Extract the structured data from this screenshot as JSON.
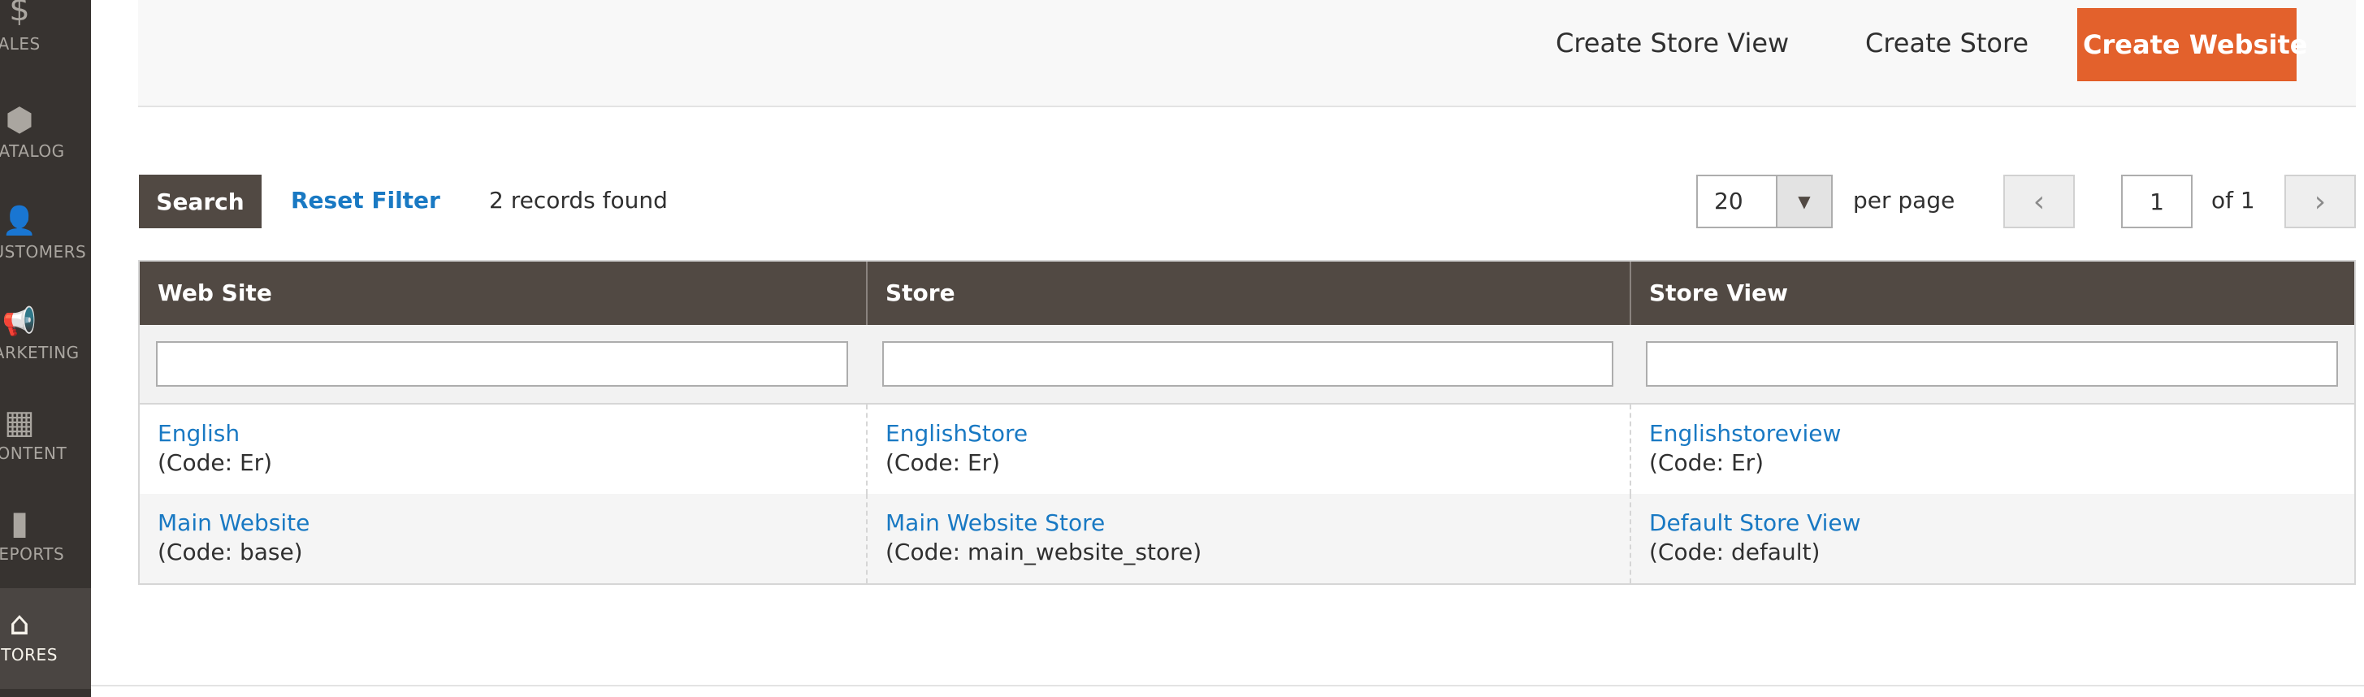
{
  "sidebar": {
    "items": [
      {
        "label": "SALES",
        "icon": "dollar-icon",
        "glyph": "$"
      },
      {
        "label": "CATALOG",
        "icon": "box-icon",
        "glyph": "⬢"
      },
      {
        "label": "CUSTOMERS",
        "icon": "person-icon",
        "glyph": "👤"
      },
      {
        "label": "MARKETING",
        "icon": "megaphone-icon",
        "glyph": "📢"
      },
      {
        "label": "CONTENT",
        "icon": "layout-icon",
        "glyph": "▦"
      },
      {
        "label": "REPORTS",
        "icon": "bar-chart-icon",
        "glyph": "▮"
      },
      {
        "label": "STORES",
        "icon": "store-icon",
        "glyph": "⌂"
      }
    ],
    "active": "STORES"
  },
  "actions": {
    "create_store_view": "Create Store View",
    "create_store": "Create Store",
    "create_website": "Create Website"
  },
  "toolbar": {
    "search": "Search",
    "reset_filter": "Reset Filter",
    "records": "2 records found",
    "per_page_value": "20",
    "per_page_label": "per page",
    "page_value": "1",
    "page_total": "of 1",
    "prev_glyph": "‹",
    "next_glyph": "›"
  },
  "grid": {
    "columns": [
      "Web Site",
      "Store",
      "Store View"
    ],
    "rows": [
      {
        "website": {
          "name": "English",
          "code": "(Code: Er)"
        },
        "store": {
          "name": "EnglishStore",
          "code": "(Code: Er)"
        },
        "store_view": {
          "name": "Englishstoreview",
          "code": "(Code: Er)"
        }
      },
      {
        "website": {
          "name": "Main Website",
          "code": "(Code: base)"
        },
        "store": {
          "name": "Main Website Store",
          "code": "(Code: main_website_store)"
        },
        "store_view": {
          "name": "Default Store View",
          "code": "(Code: default)"
        }
      }
    ]
  },
  "colors": {
    "sidebar": "#373330",
    "primary_button": "#e3612c",
    "grid_header": "#514943",
    "link": "#1979c3"
  }
}
